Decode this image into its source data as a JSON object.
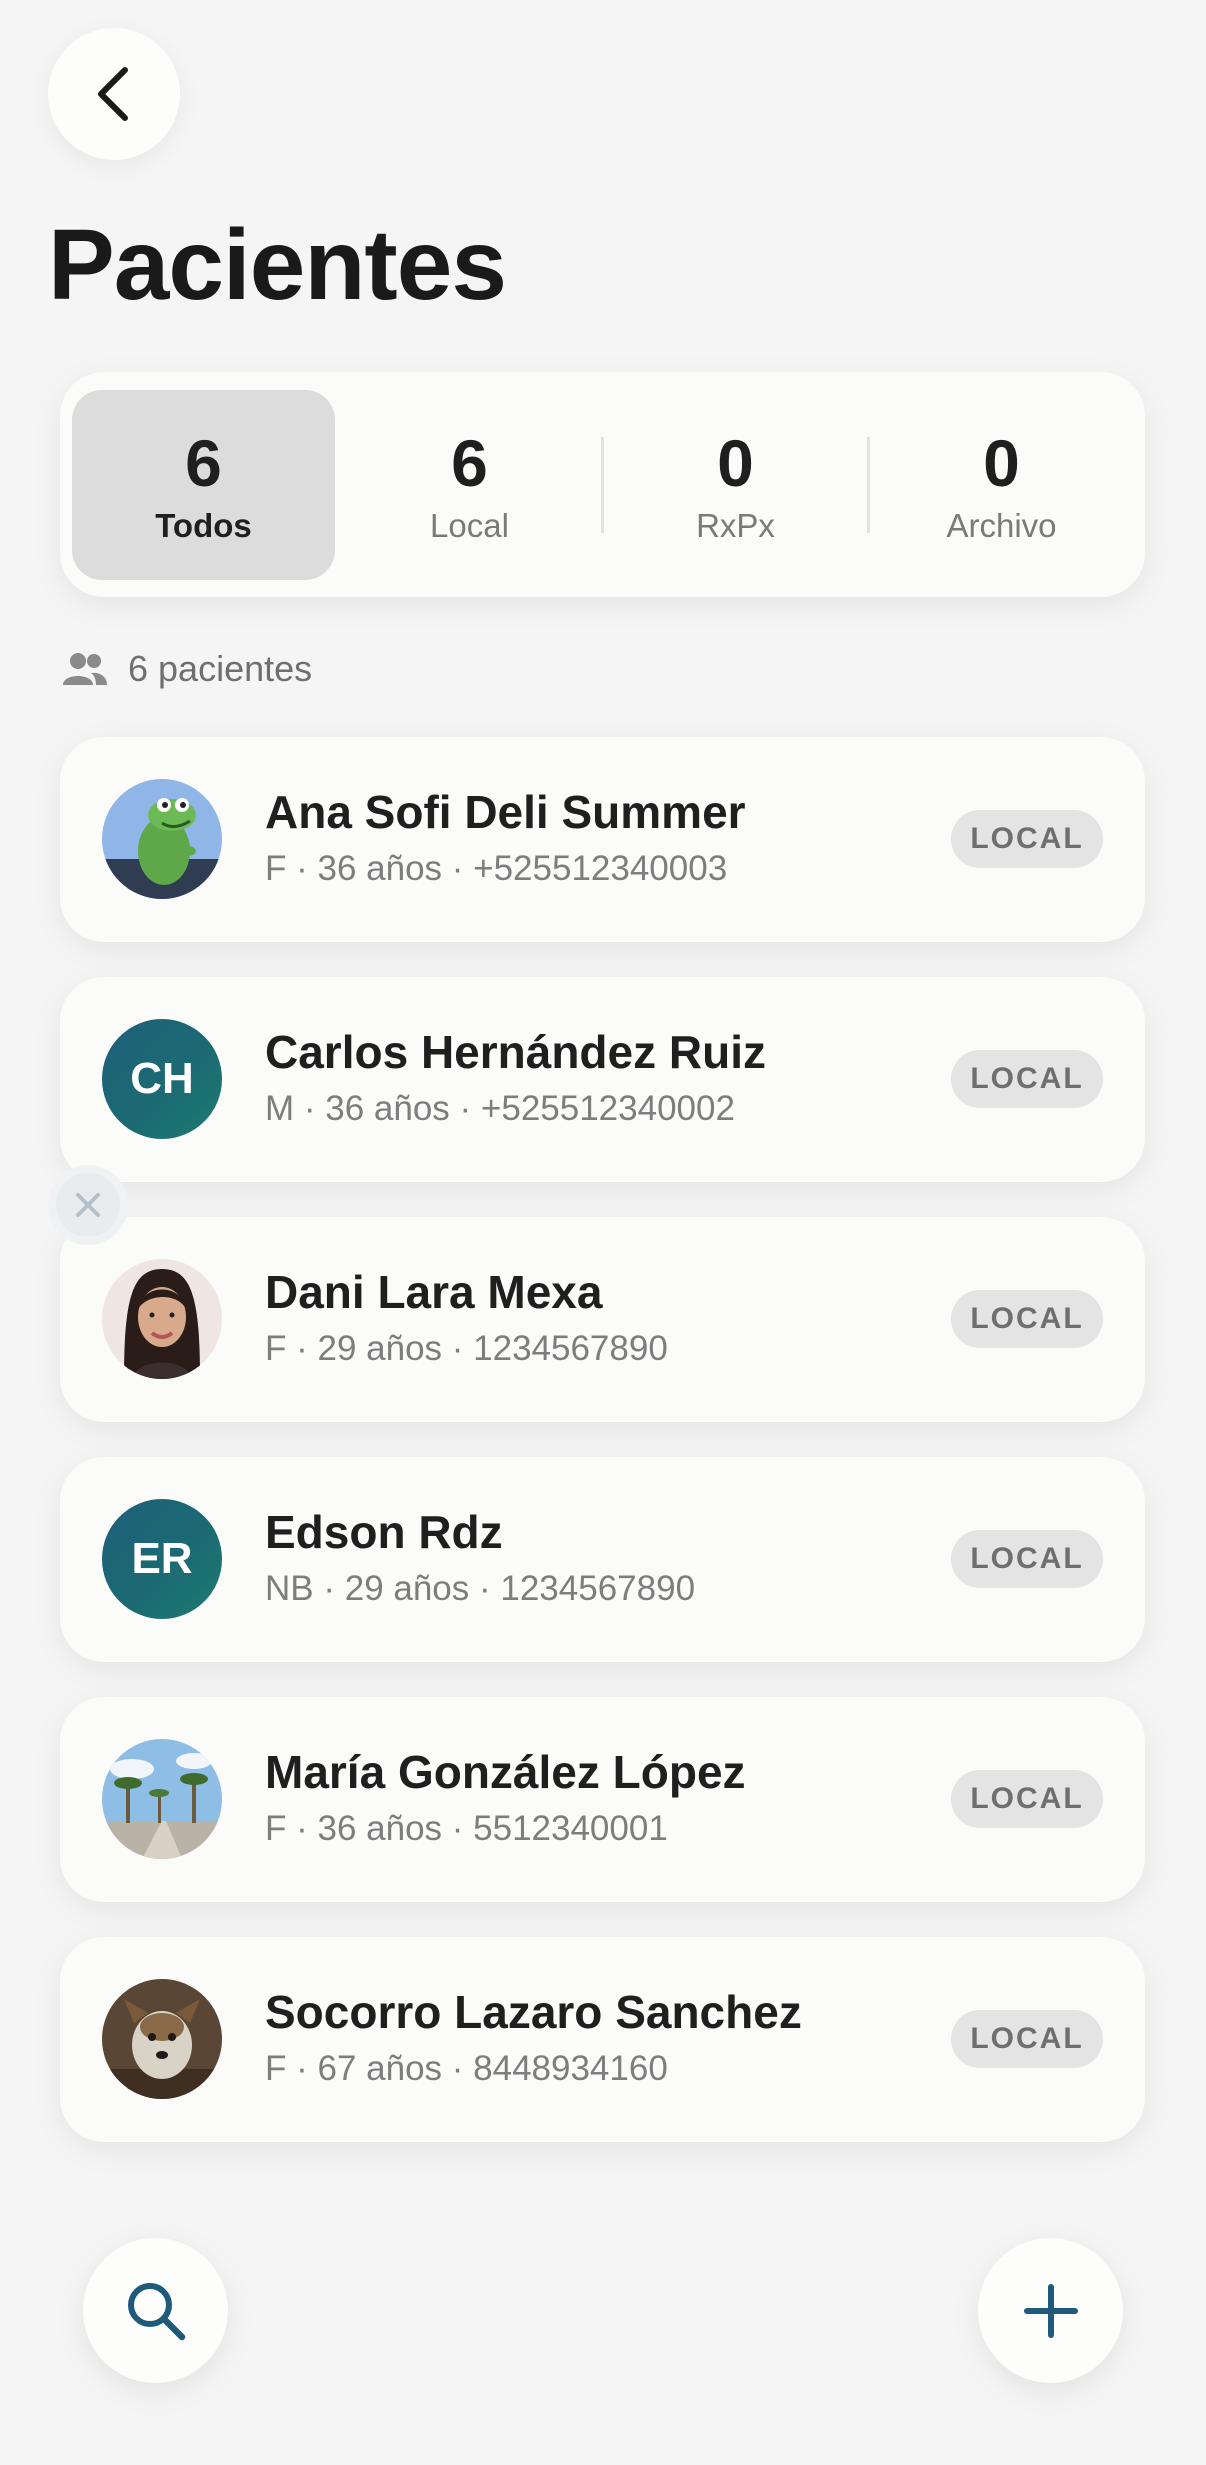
{
  "header": {
    "title": "Pacientes"
  },
  "filters": [
    {
      "count": "6",
      "label": "Todos",
      "active": true
    },
    {
      "count": "6",
      "label": "Local",
      "active": false
    },
    {
      "count": "0",
      "label": "RxPx",
      "active": false
    },
    {
      "count": "0",
      "label": "Archivo",
      "active": false
    }
  ],
  "summary": {
    "count_label": "6 pacientes"
  },
  "patients": [
    {
      "name": "Ana Sofi Deli Summer",
      "info": "F · 36 años · +525512340003",
      "badge": "LOCAL",
      "avatar": "photo-frog-toy"
    },
    {
      "name": "Carlos Hernández Ruiz",
      "info": "M · 36 años · +525512340002",
      "badge": "LOCAL",
      "avatar_initials": "CH"
    },
    {
      "name": "Dani Lara Mexa",
      "info": "F · 29 años · 1234567890",
      "badge": "LOCAL",
      "avatar": "photo-woman-portrait"
    },
    {
      "name": "Edson Rdz",
      "info": "NB · 29 años · 1234567890",
      "badge": "LOCAL",
      "avatar_initials": "ER"
    },
    {
      "name": "María González López",
      "info": "F · 36 años · 5512340001",
      "badge": "LOCAL",
      "avatar": "photo-palm-street"
    },
    {
      "name": "Socorro Lazaro Sanchez",
      "info": "F · 67 años · 8448934160",
      "badge": "LOCAL",
      "avatar": "photo-dog"
    }
  ],
  "icons": {
    "back": "chevron-left-icon",
    "people": "people-icon",
    "dismiss": "close-icon",
    "search": "search-icon",
    "add": "plus-icon"
  },
  "colors": {
    "accent": "#1f5a7a",
    "avatar_gradient_start": "#1f5f7a",
    "avatar_gradient_end": "#1e7a6e",
    "badge_bg": "#e4e4e4",
    "active_filter_bg": "#dcdcdc"
  }
}
